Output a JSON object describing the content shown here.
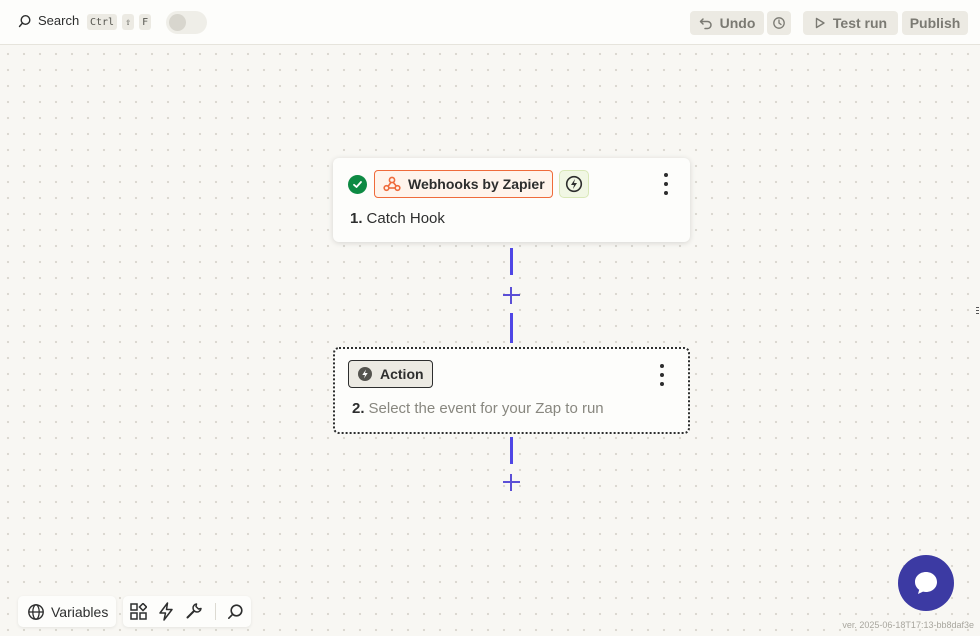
{
  "topbar": {
    "search_label": "Search",
    "shortcut_keys": [
      "Ctrl",
      "⇧",
      "F"
    ],
    "undo_label": "Undo",
    "test_run_label": "Test run",
    "publish_label": "Publish"
  },
  "steps": [
    {
      "number": "1.",
      "app_name": "Webhooks by Zapier",
      "title": "Catch Hook",
      "status": "complete"
    },
    {
      "number": "2.",
      "type_label": "Action",
      "title": "Select the event for your Zap to run"
    }
  ],
  "bottom_toolbar": {
    "variables_label": "Variables"
  },
  "version": "ver. 2025-06-18T17:13-bb8daf3e",
  "colors": {
    "accent": "#4f46e5",
    "webhook_orange": "#ef6b3b",
    "success_green": "#0d8a43",
    "chat_button": "#3c3aa3"
  },
  "icons": [
    "search-icon",
    "undo-icon",
    "history-icon",
    "play-icon",
    "check-icon",
    "webhook-icon",
    "bolt-icon",
    "globe-icon",
    "apps-icon",
    "wrench-icon",
    "chat-icon"
  ]
}
